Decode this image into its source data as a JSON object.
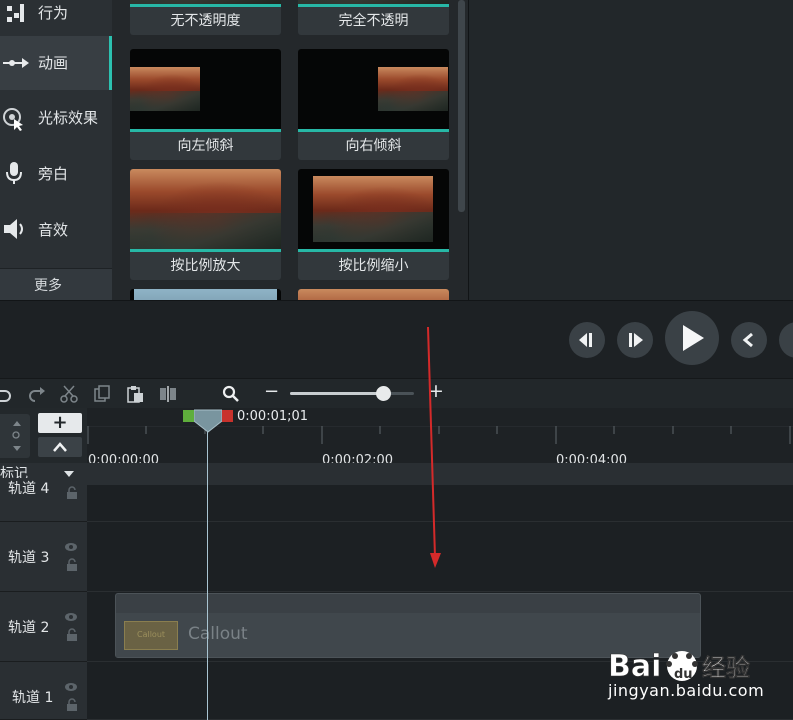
{
  "sidebar": {
    "items": [
      {
        "label": "行为",
        "icon": "behaviors-icon"
      },
      {
        "label": "动画",
        "icon": "animation-arrow-icon",
        "active": true
      },
      {
        "label": "光标效果",
        "icon": "cursor-effects-icon"
      },
      {
        "label": "旁白",
        "icon": "microphone-icon"
      },
      {
        "label": "音效",
        "icon": "speaker-icon"
      }
    ],
    "more_label": "更多"
  },
  "gallery": {
    "items": [
      {
        "caption": "无不透明度"
      },
      {
        "caption": "完全不透明"
      },
      {
        "caption": "向左倾斜"
      },
      {
        "caption": "向右倾斜"
      },
      {
        "caption": "按比例放大"
      },
      {
        "caption": "按比例缩小"
      }
    ],
    "accent_color": "#27b8a6"
  },
  "playback": {
    "buttons": [
      "step-back-icon",
      "step-forward-icon",
      "play-icon",
      "previous-marker-icon",
      "next-marker-icon"
    ]
  },
  "toolbar": {
    "zoom_minus": "−",
    "zoom_plus": "+",
    "zoom_level": 0.75
  },
  "timeline": {
    "add_track_label": "+",
    "collapse_label": "^",
    "playhead_time": "0:00:01;01",
    "ruler_labels": [
      "0:00:00;00",
      "0:00:02;00",
      "0:00:04;00"
    ],
    "marker_label": "标记",
    "tracks": [
      {
        "name": "轨道 4"
      },
      {
        "name": "轨道 3"
      },
      {
        "name": "轨道 2"
      },
      {
        "name": "轨道 1"
      }
    ],
    "clip": {
      "label": "Callout",
      "swatch_text": "Callout"
    }
  },
  "annotation_color": "#d42a2a",
  "watermark": {
    "brand": "Bai du 经验",
    "url": "jingyan.baidu.com"
  }
}
